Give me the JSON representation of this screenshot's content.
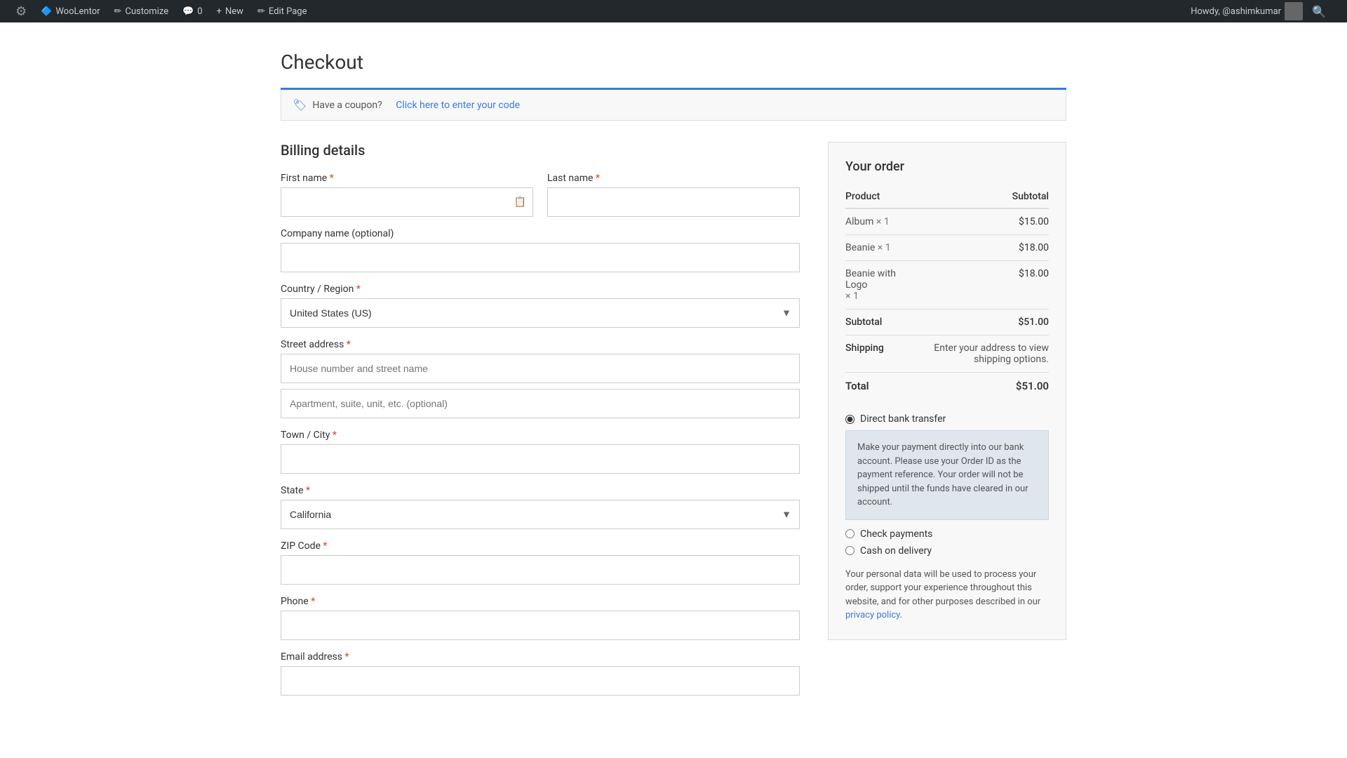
{
  "adminBar": {
    "items": [
      {
        "id": "wp-logo",
        "icon": "⚙",
        "label": ""
      },
      {
        "id": "woolentor",
        "icon": "🔷",
        "label": "WooLentor"
      },
      {
        "id": "customize",
        "icon": "✏",
        "label": "Customize"
      },
      {
        "id": "comments",
        "icon": "💬",
        "label": "0"
      },
      {
        "id": "new",
        "icon": "+",
        "label": "New"
      },
      {
        "id": "edit-page",
        "icon": "✏",
        "label": "Edit Page"
      }
    ],
    "greeting": "Howdy, @ashimkumar"
  },
  "page": {
    "title": "Checkout"
  },
  "coupon": {
    "text": "Have a coupon?",
    "linkText": "Click here to enter your code"
  },
  "billing": {
    "sectionTitle": "Billing details",
    "fields": {
      "firstName": {
        "label": "First name",
        "required": true,
        "placeholder": ""
      },
      "lastName": {
        "label": "Last name",
        "required": true,
        "placeholder": ""
      },
      "companyName": {
        "label": "Company name (optional)",
        "required": false,
        "placeholder": ""
      },
      "countryRegion": {
        "label": "Country / Region",
        "required": true,
        "value": "United States (US)"
      },
      "streetAddress": {
        "label": "Street address",
        "required": true,
        "placeholder": "House number and street name",
        "placeholder2": "Apartment, suite, unit, etc. (optional)"
      },
      "townCity": {
        "label": "Town / City",
        "required": true,
        "placeholder": ""
      },
      "state": {
        "label": "State",
        "required": true,
        "value": "California"
      },
      "zipCode": {
        "label": "ZIP Code",
        "required": true,
        "placeholder": ""
      },
      "phone": {
        "label": "Phone",
        "required": true,
        "placeholder": ""
      },
      "emailAddress": {
        "label": "Email address",
        "required": true,
        "placeholder": ""
      }
    }
  },
  "order": {
    "title": "Your order",
    "columns": {
      "product": "Product",
      "subtotal": "Subtotal"
    },
    "items": [
      {
        "name": "Album",
        "qty": "× 1",
        "price": "$15.00"
      },
      {
        "name": "Beanie",
        "qty": "× 1",
        "price": "$18.00"
      },
      {
        "name": "Beanie with Logo",
        "qty": "× 1",
        "price": "$18.00"
      }
    ],
    "subtotalLabel": "Subtotal",
    "subtotalValue": "$51.00",
    "shippingLabel": "Shipping",
    "shippingNote": "Enter your address to view shipping options.",
    "totalLabel": "Total",
    "totalValue": "$51.00"
  },
  "payment": {
    "options": [
      {
        "id": "direct-bank",
        "label": "Direct bank transfer",
        "checked": true,
        "description": "Make your payment directly into our bank account. Please use your Order ID as the payment reference. Your order will not be shipped until the funds have cleared in our account."
      },
      {
        "id": "check-payments",
        "label": "Check payments",
        "checked": false,
        "description": ""
      },
      {
        "id": "cash-delivery",
        "label": "Cash on delivery",
        "checked": false,
        "description": ""
      }
    ],
    "privacyNotice": "Your personal data will be used to process your order, support your experience throughout this website, and for other purposes described in our",
    "privacyLinkText": "privacy policy",
    "privacyNoticeSuffix": "."
  }
}
